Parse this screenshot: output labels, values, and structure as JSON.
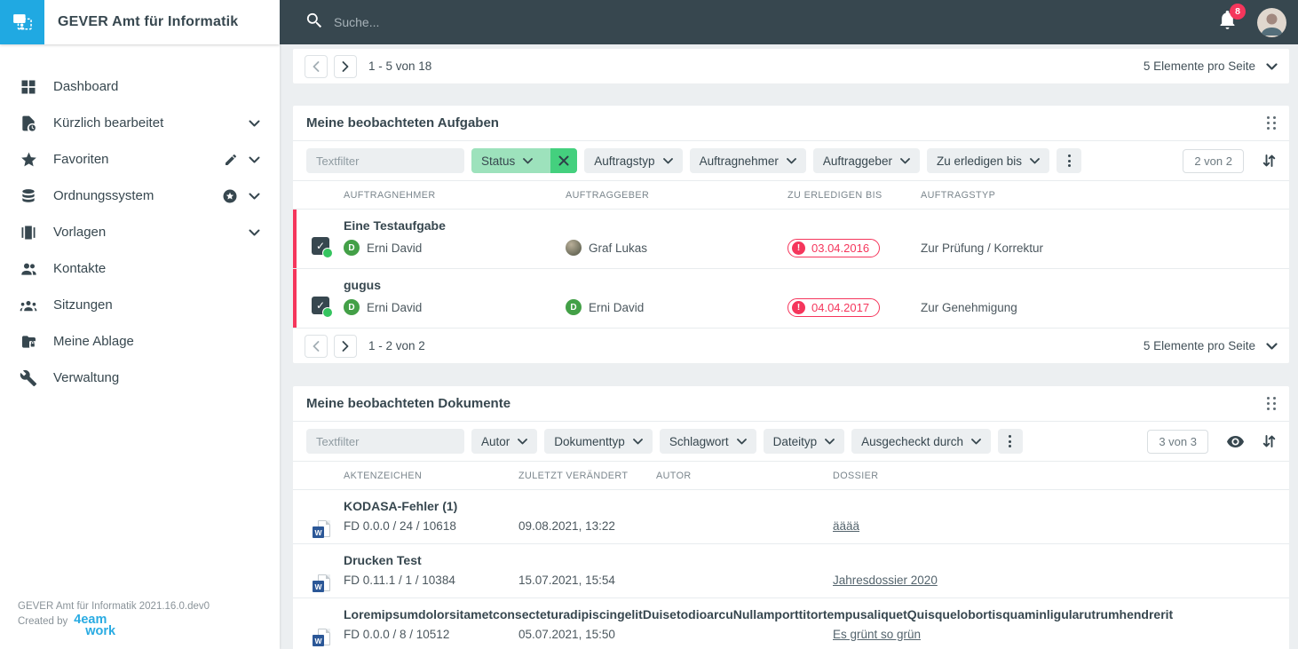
{
  "topbar": {
    "app_title": "GEVER Amt für Informatik",
    "search_placeholder": "Suche...",
    "notification_count": "8"
  },
  "sidebar": {
    "items": [
      {
        "label": "Dashboard",
        "icon": "dashboard-icon"
      },
      {
        "label": "Kürzlich bearbeitet",
        "icon": "recent-document-icon",
        "expandable": true
      },
      {
        "label": "Favoriten",
        "icon": "star-icon",
        "expandable": true,
        "editable": true
      },
      {
        "label": "Ordnungssystem",
        "icon": "database-icon",
        "expandable": true,
        "favorite_badge": true
      },
      {
        "label": "Vorlagen",
        "icon": "templates-icon",
        "expandable": true
      },
      {
        "label": "Kontakte",
        "icon": "contacts-icon"
      },
      {
        "label": "Sitzungen",
        "icon": "meetings-icon"
      },
      {
        "label": "Meine Ablage",
        "icon": "private-folder-icon"
      },
      {
        "label": "Verwaltung",
        "icon": "wrench-icon"
      }
    ],
    "footer": {
      "version": "GEVER Amt für Informatik 2021.16.0.dev0",
      "created_by": "Created by",
      "brand_line1": "4eam",
      "brand_line2": "work"
    }
  },
  "top_pager": {
    "range": "1 - 5 von 18",
    "per_page": "5 Elemente pro Seite"
  },
  "tasks_panel": {
    "title": "Meine beobachteten Aufgaben",
    "textfilter_placeholder": "Textfilter",
    "active_filter": {
      "label": "Status"
    },
    "filters": [
      "Auftragstyp",
      "Auftragnehmer",
      "Auftraggeber",
      "Zu erledigen bis"
    ],
    "result_count": "2 von 2",
    "columns": [
      "AUFTRAGNEHMER",
      "AUFTRAGGEBER",
      "ZU ERLEDIGEN BIS",
      "AUFTRAGSTYP"
    ],
    "rows": [
      {
        "title": "Eine Testaufgabe",
        "assignee": "Erni David",
        "assignee_badge": "D",
        "issuer": "Graf Lukas",
        "due": "03.04.2016",
        "type": "Zur Prüfung / Korrektur"
      },
      {
        "title": "gugus",
        "assignee": "Erni David",
        "assignee_badge": "D",
        "issuer": "Erni David",
        "issuer_badge": "D",
        "due": "04.04.2017",
        "type": "Zur Genehmigung"
      }
    ],
    "pager": {
      "range": "1 - 2 von 2",
      "per_page": "5 Elemente pro Seite"
    }
  },
  "docs_panel": {
    "title": "Meine beobachteten Dokumente",
    "textfilter_placeholder": "Textfilter",
    "filters": [
      "Autor",
      "Dokumenttyp",
      "Schlagwort",
      "Dateityp",
      "Ausgecheckt durch"
    ],
    "result_count": "3 von 3",
    "columns": [
      "AKTENZEICHEN",
      "ZULETZT VERÄNDERT",
      "AUTOR",
      "DOSSIER"
    ],
    "rows": [
      {
        "title": "KODASA-Fehler (1)",
        "reference": "FD 0.0.0 / 24 / 10618",
        "modified": "09.08.2021, 13:22",
        "author": "",
        "dossier": "ääää"
      },
      {
        "title": "Drucken Test",
        "reference": "FD 0.11.1 / 1 / 10384",
        "modified": "15.07.2021, 15:54",
        "author": "",
        "dossier": "Jahresdossier 2020"
      },
      {
        "title": "LoremipsumdolorsitametconsecteturadipiscingelitDuisetodioarcuNullamporttitortempusaliquetQuisquelobortisquaminligularutrumhendrerit",
        "reference": "FD 0.0.0 / 8 / 10512",
        "modified": "05.07.2021, 15:50",
        "author": "",
        "dossier": "Es grünt so grün"
      }
    ]
  },
  "word_doc_letter": "W",
  "colors": {
    "accent_blue": "#20a9e2",
    "topbar_dark": "#37474f",
    "danger_red": "#f5365c",
    "filter_green_light": "#9de2bc",
    "filter_green_strong": "#44d07e",
    "avatar_green": "#43a047",
    "brand_cyan": "#29abe2",
    "main_background": "#eceff1"
  },
  "icons": {
    "app-logo-icon": "dual-screens-with-person",
    "search-icon": "magnifier",
    "bell-icon": "bell",
    "avatar": "user-photo-circle",
    "dashboard-icon": "four-squares-grid",
    "recent-document-icon": "document-with-clock",
    "star-icon": "star",
    "database-icon": "stacked-discs",
    "templates-icon": "library-books",
    "contacts-icon": "two-people",
    "meetings-icon": "people-group",
    "private-folder-icon": "folder-with-lock",
    "wrench-icon": "wrench",
    "pencil-icon": "pencil",
    "favorite-badge-icon": "star-in-circle",
    "chevron-down-icon": "v",
    "chevron-left-icon": "<",
    "chevron-right-icon": ">",
    "close-icon": "x",
    "kebab-icon": "three-vertical-dots",
    "drag-handle-icon": "six-dots",
    "sort-icon": "down-up-arrows",
    "eye-icon": "eye",
    "overdue-icon": "exclamation-circle",
    "task-icon": "dark-checkbox-with-green-dot",
    "word-document-icon": "word-page"
  }
}
